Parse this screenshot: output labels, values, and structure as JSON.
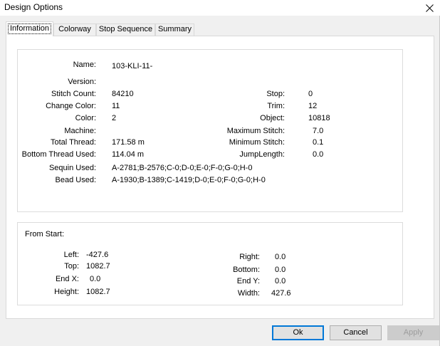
{
  "window": {
    "title": "Design Options"
  },
  "tabs": [
    {
      "label": "Information"
    },
    {
      "label": "Colorway"
    },
    {
      "label": "Stop Sequence"
    },
    {
      "label": "Summary"
    }
  ],
  "info": {
    "name_label": "Name:",
    "name_value": "103-KLI-11-",
    "version_label": "Version:",
    "version_value": "",
    "stitch_count_label": "Stitch Count:",
    "stitch_count_value": "84210",
    "change_color_label": "Change Color:",
    "change_color_value": "11",
    "color_label": "Color:",
    "color_value": "2",
    "machine_label": "Machine:",
    "machine_value": "",
    "total_thread_label": "Total Thread:",
    "total_thread_value": "171.58 m",
    "bottom_thread_label": "Bottom Thread Used:",
    "bottom_thread_value": "114.04 m",
    "sequin_label": "Sequin Used:",
    "sequin_value": "A-2781;B-2576;C-0;D-0;E-0;F-0;G-0;H-0",
    "bead_label": "Bead Used:",
    "bead_value": "A-1930;B-1389;C-1419;D-0;E-0;F-0;G-0;H-0",
    "stop_label": "Stop:",
    "stop_value": "0",
    "trim_label": "Trim:",
    "trim_value": "12",
    "object_label": "Object:",
    "object_value": "10818",
    "max_stitch_label": "Maximum Stitch:",
    "max_stitch_value": "7.0",
    "min_stitch_label": "Minimum Stitch:",
    "min_stitch_value": "0.1",
    "jump_length_label": "JumpLength:",
    "jump_length_value": "0.0"
  },
  "extent": {
    "header": "From Start:",
    "left_label": "Left:",
    "left_value": "-427.6",
    "top_label": "Top:",
    "top_value": "1082.7",
    "end_x_label": "End X:",
    "end_x_value": "0.0",
    "height_label": "Height:",
    "height_value": "1082.7",
    "right_label": "Right:",
    "right_value": "0.0",
    "bottom_label": "Bottom:",
    "bottom_value": "0.0",
    "end_y_label": "End Y:",
    "end_y_value": "0.0",
    "width_label": "Width:",
    "width_value": "427.6"
  },
  "buttons": {
    "ok": "Ok",
    "cancel": "Cancel",
    "apply": "Apply"
  },
  "icons": {
    "close": "close-icon"
  },
  "colors": {
    "default_button_border": "#0078d7",
    "disabled_text": "#9c9c9c"
  }
}
